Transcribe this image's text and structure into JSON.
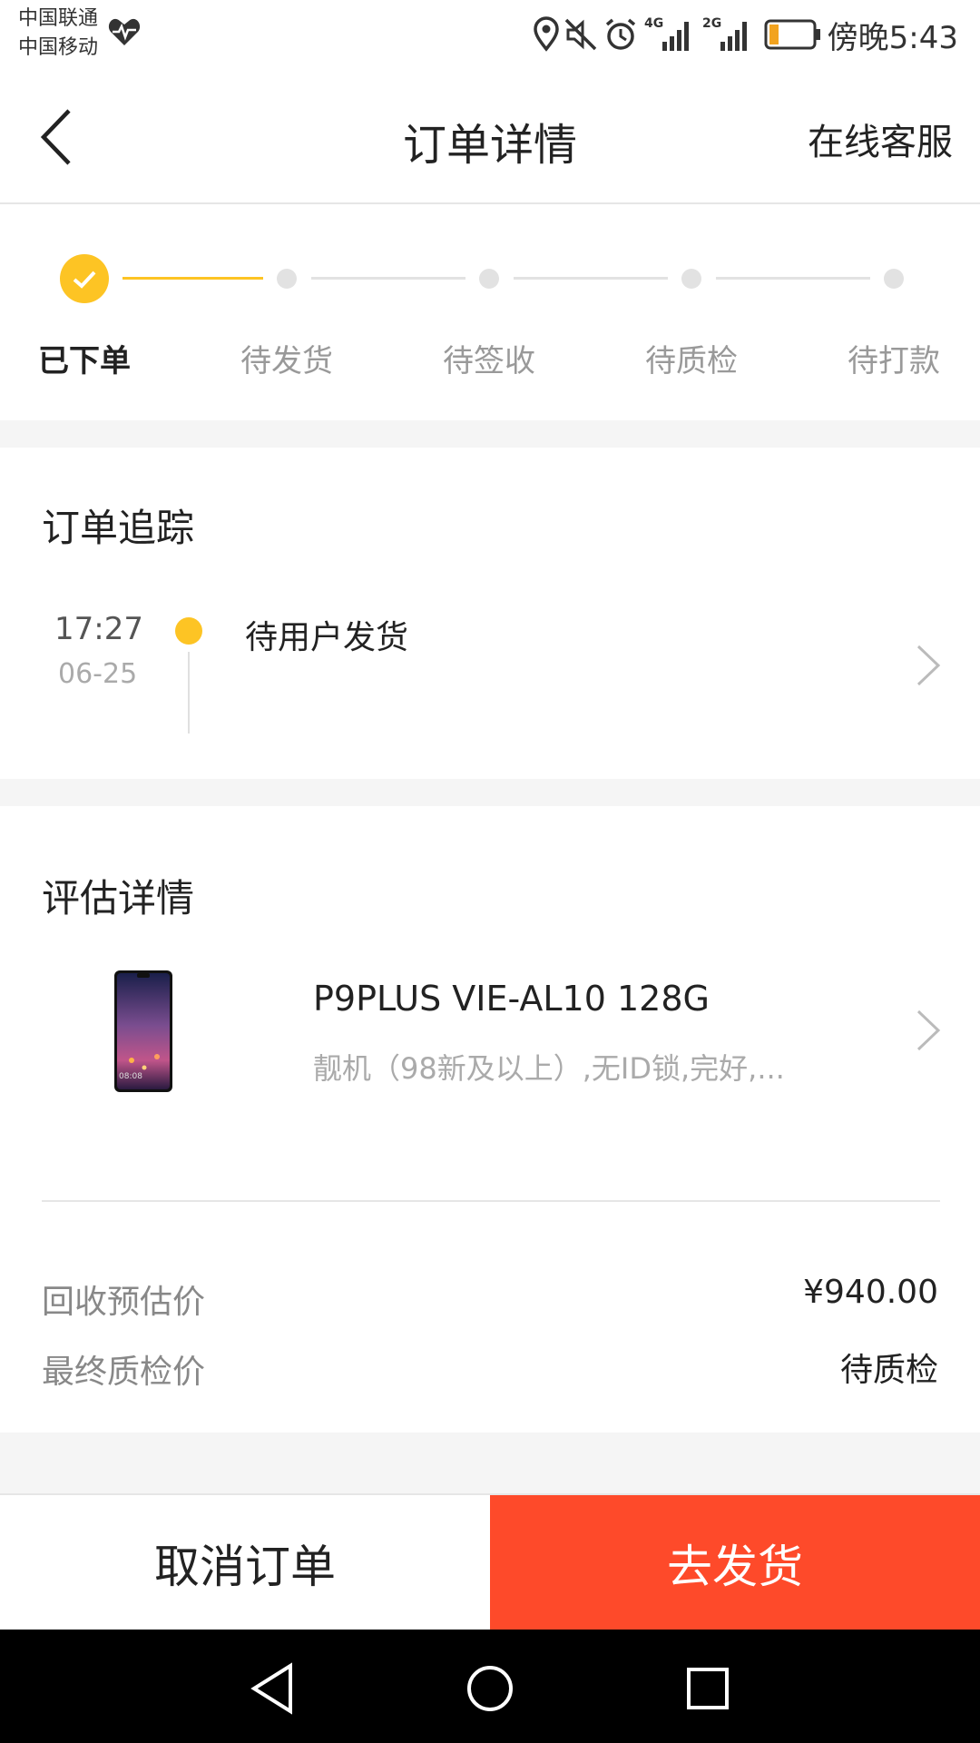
{
  "status_bar": {
    "carrier_1": "中国联通",
    "carrier_2": "中国移动",
    "network_1": "4G",
    "network_2": "2G",
    "time": "傍晚5:43",
    "icons": [
      "heart-rate-icon",
      "location-icon",
      "mute-icon",
      "alarm-icon",
      "signal-4g-icon",
      "signal-2g-icon",
      "battery-icon"
    ]
  },
  "nav": {
    "title": "订单详情",
    "service": "在线客服"
  },
  "progress": {
    "steps": [
      {
        "label": "已下单",
        "done": true
      },
      {
        "label": "待发货",
        "done": false
      },
      {
        "label": "待签收",
        "done": false
      },
      {
        "label": "待质检",
        "done": false
      },
      {
        "label": "待打款",
        "done": false
      }
    ]
  },
  "tracking": {
    "title": "订单追踪",
    "time": "17:27",
    "date": "06-25",
    "status": "待用户发货"
  },
  "evaluation": {
    "title": "评估详情",
    "product_name": "P9PLUS VIE-AL10 128G",
    "product_desc": "靓机（98新及以上）,无ID锁,完好,...",
    "phone_clock": "08:08",
    "estimate_label": "回收预估价",
    "estimate_value": "¥940.00",
    "final_label": "最终质检价",
    "final_value": "待质检"
  },
  "footer": {
    "cancel": "取消订单",
    "ship": "去发货"
  },
  "colors": {
    "accent_yellow": "#fdc424",
    "action_red": "#fe4a2a"
  }
}
